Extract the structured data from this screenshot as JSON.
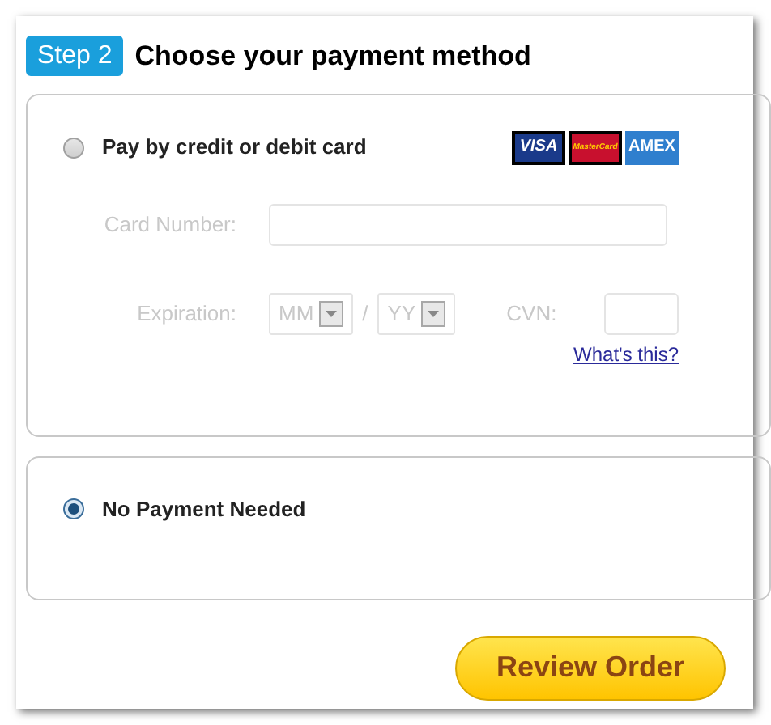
{
  "step_badge": "Step 2",
  "title": "Choose your payment method",
  "options": [
    {
      "kind": "card",
      "label": "Pay by credit or debit card",
      "selected": false,
      "card_logos": [
        {
          "kind": "visa",
          "text": "VISA"
        },
        {
          "kind": "mastercard",
          "text": "MasterCard"
        },
        {
          "kind": "amex",
          "text": "AMEX"
        }
      ],
      "fields_disabled": true,
      "card_number_label": "Card Number:",
      "expiration_label": "Expiration:",
      "month": "MM",
      "separator": "/",
      "year": "YY",
      "cvn_label": "CVN:",
      "help_link": "What's this?"
    },
    {
      "kind": "none",
      "label": "No Payment Needed",
      "selected": true
    }
  ],
  "submit_button": "Review Order"
}
